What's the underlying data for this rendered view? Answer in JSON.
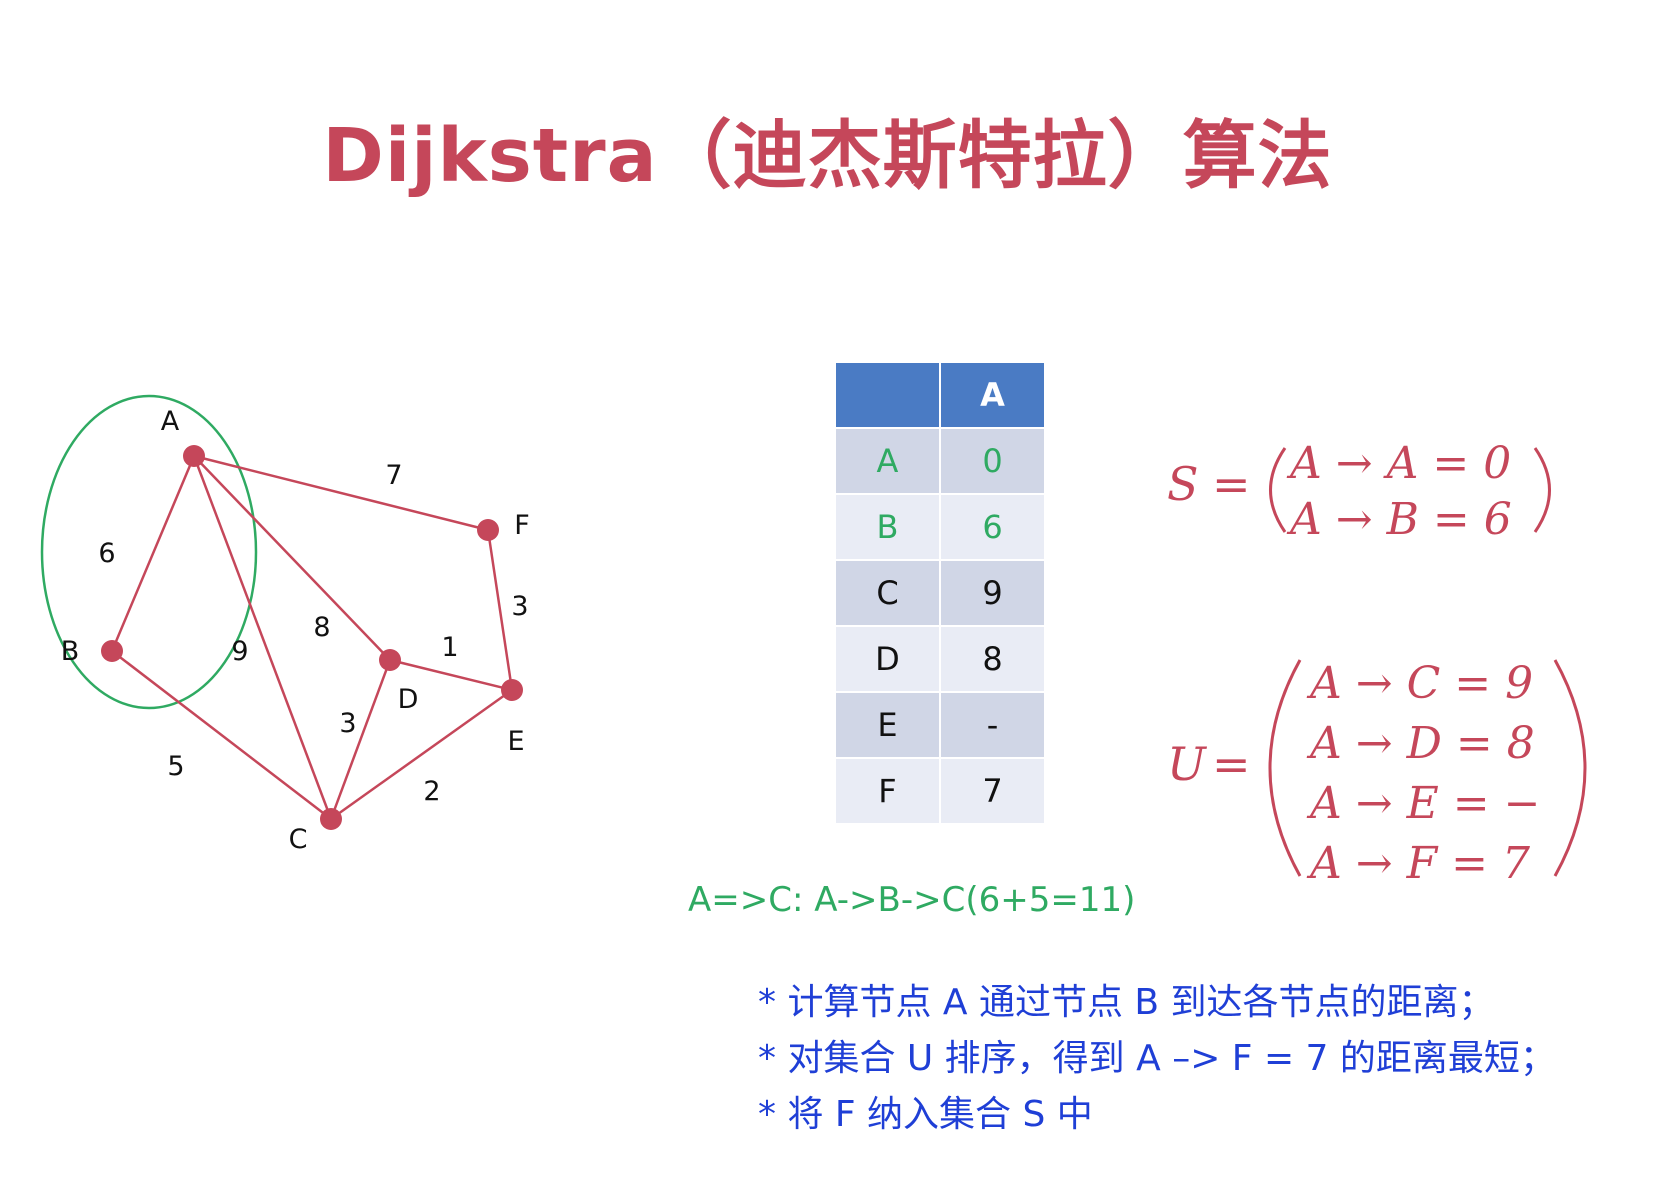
{
  "title": "Dijkstra（迪杰斯特拉）算法",
  "colors": {
    "accent": "#c5475a",
    "highlight_green": "#2faa62",
    "note_blue": "#1f3fd6",
    "table_header": "#4a7bc4",
    "table_row_dark": "#d0d6e6",
    "table_row_light": "#e9ecf5"
  },
  "graph": {
    "nodes": [
      {
        "id": "A",
        "label": "A"
      },
      {
        "id": "B",
        "label": "B"
      },
      {
        "id": "C",
        "label": "C"
      },
      {
        "id": "D",
        "label": "D"
      },
      {
        "id": "E",
        "label": "E"
      },
      {
        "id": "F",
        "label": "F"
      }
    ],
    "edges": [
      {
        "from": "A",
        "to": "B",
        "weight": "6"
      },
      {
        "from": "A",
        "to": "C",
        "weight": "9"
      },
      {
        "from": "A",
        "to": "D",
        "weight": "8"
      },
      {
        "from": "A",
        "to": "F",
        "weight": "7"
      },
      {
        "from": "B",
        "to": "C",
        "weight": "5"
      },
      {
        "from": "C",
        "to": "D",
        "weight": "3"
      },
      {
        "from": "C",
        "to": "E",
        "weight": "2"
      },
      {
        "from": "D",
        "to": "E",
        "weight": "1"
      },
      {
        "from": "F",
        "to": "E",
        "weight": "3"
      }
    ],
    "visited_set": [
      "A",
      "B"
    ]
  },
  "table": {
    "headers": [
      "",
      "A"
    ],
    "rows": [
      {
        "node": "A",
        "dist": "0",
        "done": true
      },
      {
        "node": "B",
        "dist": "6",
        "done": true
      },
      {
        "node": "C",
        "dist": "9",
        "done": false
      },
      {
        "node": "D",
        "dist": "8",
        "done": false
      },
      {
        "node": "E",
        "dist": "-",
        "done": false
      },
      {
        "node": "F",
        "dist": "7",
        "done": false
      }
    ]
  },
  "path_note": "A=>C: A->B->C(6+5=11)",
  "set_s": {
    "name": "S",
    "equals": "=",
    "entries": [
      "A → A = 0",
      "A → B = 6"
    ]
  },
  "set_u": {
    "name": "U",
    "equals": "=",
    "entries": [
      "A → C = 9",
      "A → D = 8",
      "A → E = −",
      "A → F = 7"
    ]
  },
  "notes": [
    "* 计算节点 A 通过节点 B 到达各节点的距离；",
    "* 对集合 U 排序，得到 A –> F = 7 的距离最短；",
    "* 将 F 纳入集合 S 中"
  ]
}
